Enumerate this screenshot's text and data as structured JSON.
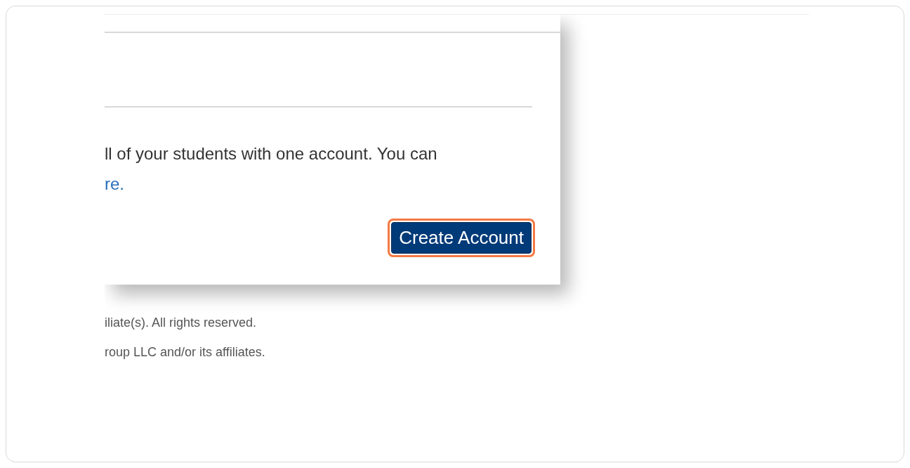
{
  "dialog": {
    "body_text": "ll of your students with one account. You can",
    "link_text": "re.",
    "button": {
      "label": "Create Account",
      "highlighted": true
    }
  },
  "footer": [
    "iliate(s). All rights reserved.",
    "roup LLC and/or its affiliates."
  ]
}
